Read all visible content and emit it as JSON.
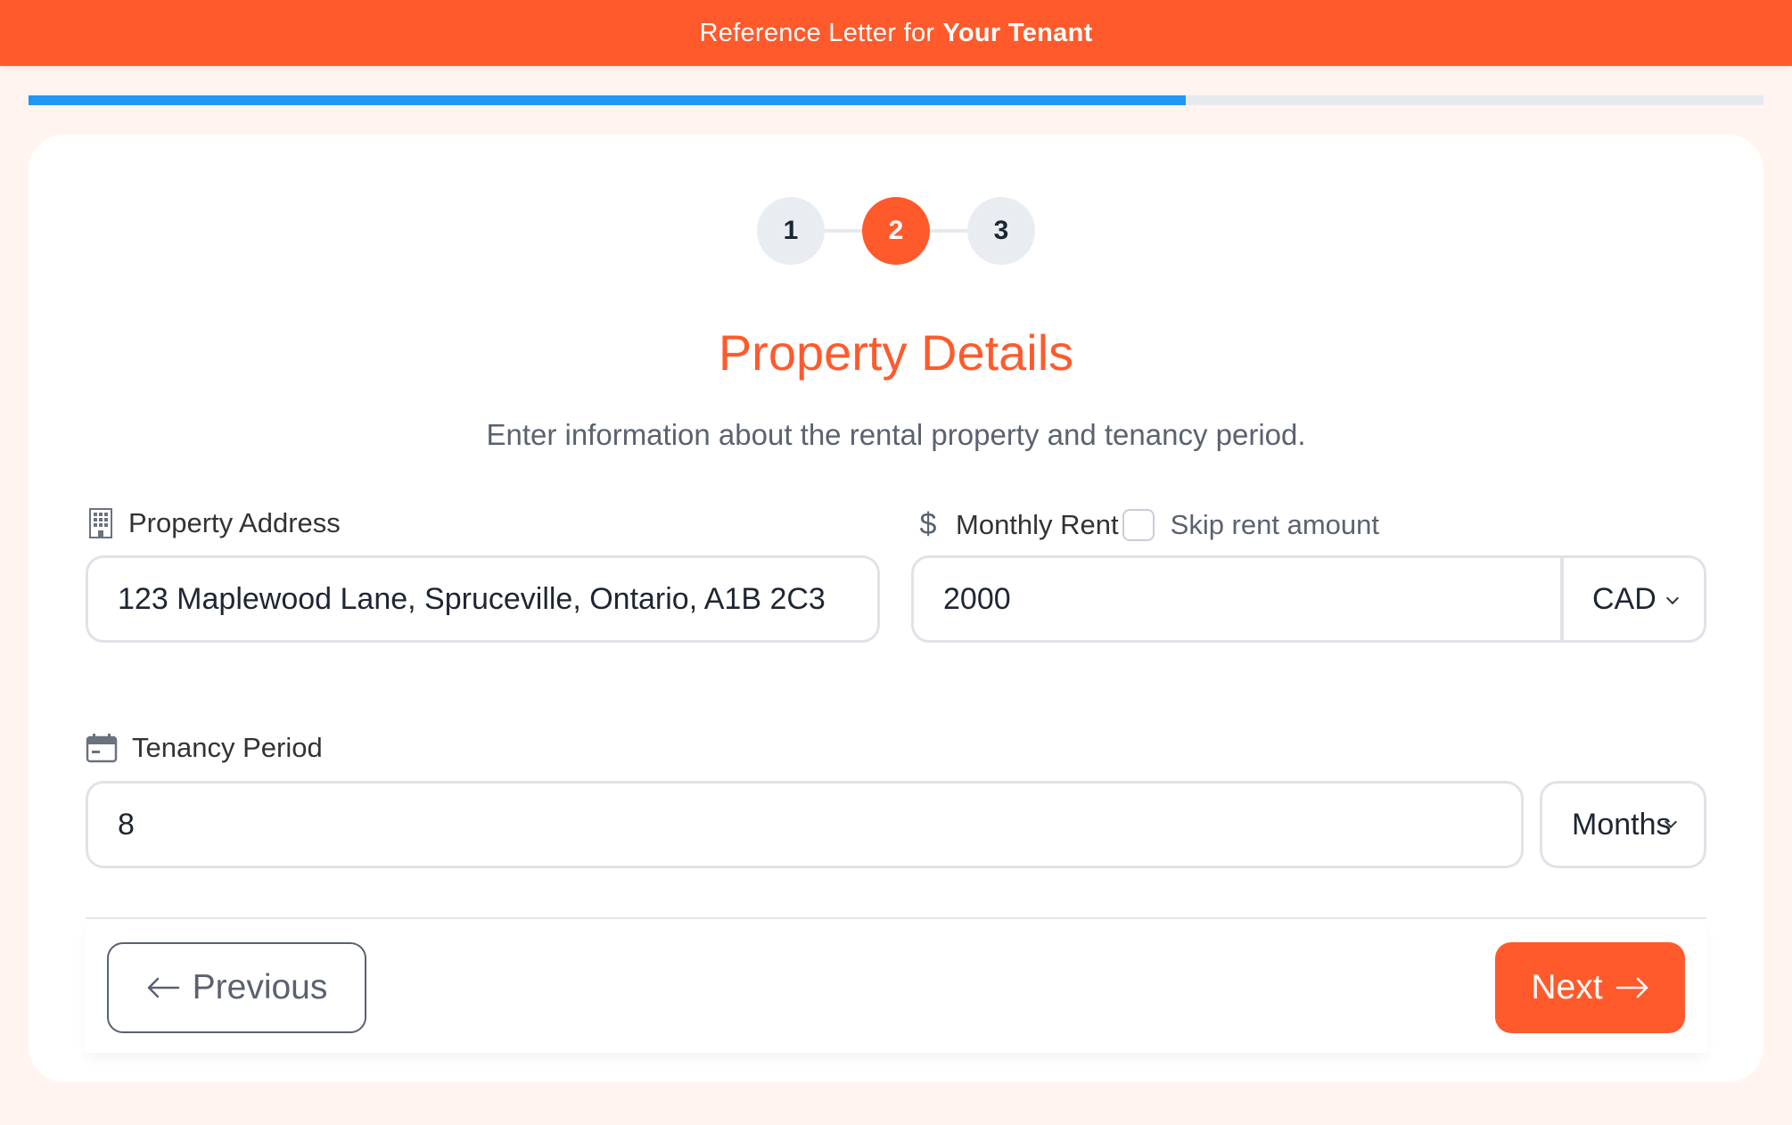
{
  "header": {
    "title_prefix": "Reference Letter for",
    "title_emphasis": "Your Tenant",
    "accent_color": "#ff5a2c"
  },
  "progress": {
    "fraction": 0.667,
    "fill_color": "#2196f3"
  },
  "stepper": {
    "steps": [
      "1",
      "2",
      "3"
    ],
    "active_index": 1
  },
  "section": {
    "title": "Property Details",
    "subtitle": "Enter information about the rental property and tenancy period."
  },
  "property_address": {
    "label": "Property Address",
    "icon": "building-icon",
    "value": "123 Maplewood Lane, Spruceville, Ontario, A1B 2C3"
  },
  "monthly_rent": {
    "label": "Monthly Rent",
    "icon": "dollar-icon",
    "skip_label": "Skip rent amount",
    "skip_checked": false,
    "value": "2000",
    "currency": "CAD"
  },
  "tenancy_period": {
    "label": "Tenancy Period",
    "icon": "calendar-icon",
    "value": "8",
    "unit": "Months"
  },
  "navigation": {
    "previous_label": "Previous",
    "next_label": "Next"
  }
}
